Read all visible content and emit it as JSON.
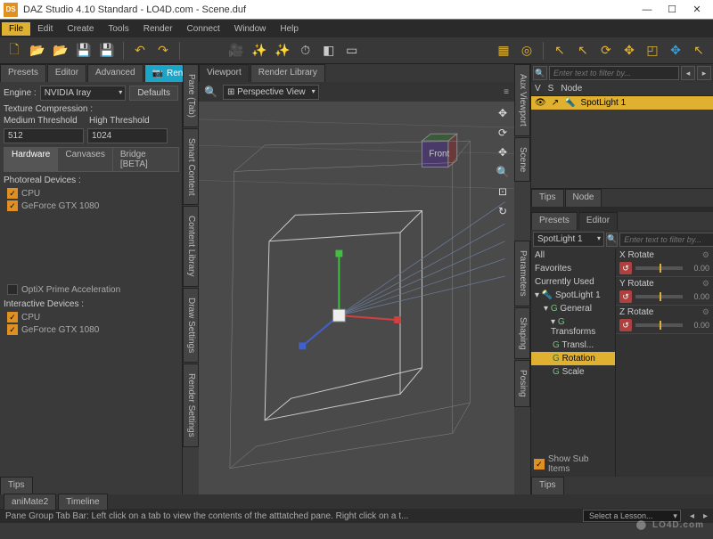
{
  "app": {
    "title": "DAZ Studio 4.10 Standard - LO4D.com - Scene.duf",
    "icon_text": "DS",
    "watermark": "LO4D.com"
  },
  "menubar": [
    "File",
    "Edit",
    "Create",
    "Tools",
    "Render",
    "Connect",
    "Window",
    "Help"
  ],
  "menubar_active": "File",
  "left": {
    "tabs": {
      "presets": "Presets",
      "editor": "Editor",
      "advanced": "Advanced",
      "render": "Render"
    },
    "engine_label": "Engine :",
    "engine_value": "NVIDIA Iray",
    "defaults_btn": "Defaults",
    "texture_comp": "Texture Compression :",
    "medium_label": "Medium Threshold",
    "high_label": "High Threshold",
    "medium_val": "512",
    "high_val": "1024",
    "subtabs": {
      "hardware": "Hardware",
      "canvases": "Canvases",
      "bridge": "Bridge [BETA]"
    },
    "photoreal": "Photoreal Devices :",
    "dev_cpu": "CPU",
    "dev_gpu": "GeForce GTX 1080",
    "optix": "OptiX Prime Acceleration",
    "interactive": "Interactive Devices :",
    "tips": "Tips"
  },
  "side_tabs_left": [
    "Pane (Tab)",
    "Smart Content",
    "Content Library",
    "Draw Settings",
    "Render Settings"
  ],
  "viewport": {
    "tabs": {
      "viewport": "Viewport",
      "render_library": "Render Library"
    },
    "view_mode": "Perspective View"
  },
  "side_tabs_right": [
    "Aux Viewport",
    "Scene"
  ],
  "scene": {
    "filter_placeholder": "Enter text to filter by...",
    "cols": {
      "v": "V",
      "s": "S",
      "node": "Node"
    },
    "item": "SpotLight 1"
  },
  "mid_tabs": {
    "tips": "Tips",
    "node": "Node"
  },
  "param_side_tabs": [
    "Parameters",
    "Shaping",
    "Posing"
  ],
  "editor": {
    "tabs": {
      "presets": "Presets",
      "editor": "Editor"
    },
    "selected": "SpotLight 1",
    "filter_placeholder": "Enter text to filter by...",
    "tree": {
      "all": "All",
      "favorites": "Favorites",
      "currently_used": "Currently Used",
      "spotlight": "SpotLight 1",
      "general": "General",
      "transforms": "Transforms",
      "translate": "Transl...",
      "rotation": "Rotation",
      "scale": "Scale"
    },
    "props": {
      "x": {
        "label": "X Rotate",
        "val": "0.00"
      },
      "y": {
        "label": "Y Rotate",
        "val": "0.00"
      },
      "z": {
        "label": "Z Rotate",
        "val": "0.00"
      }
    },
    "show_sub": "Show Sub Items",
    "tips": "Tips"
  },
  "bottom": {
    "animate": "aniMate2",
    "timeline": "Timeline",
    "status": "Pane Group Tab Bar: Left click on a tab to view the contents of the atttatched pane. Right click on a t...",
    "lesson": "Select a Lesson..."
  }
}
